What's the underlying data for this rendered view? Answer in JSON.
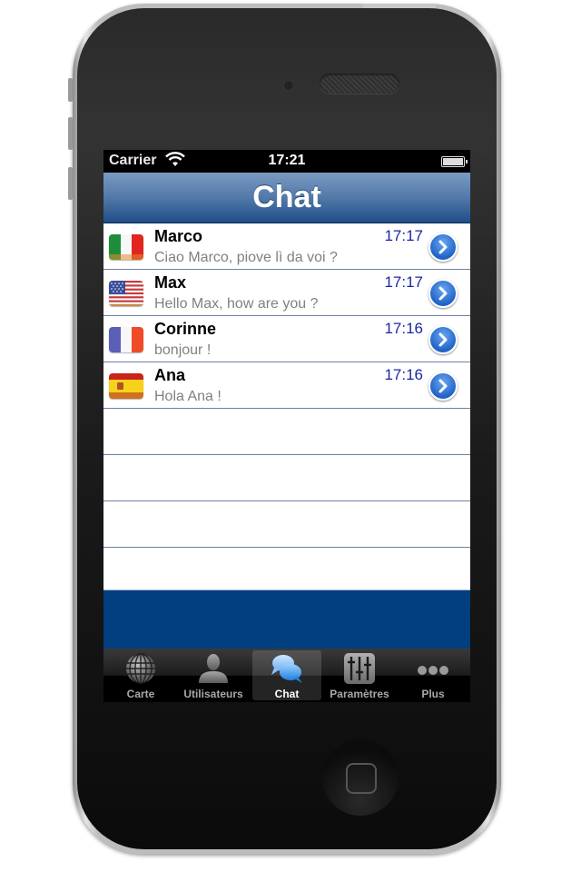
{
  "status_bar": {
    "carrier": "Carrier",
    "time": "17:21",
    "wifi_icon": "wifi-icon",
    "battery_icon": "battery-icon"
  },
  "nav_bar": {
    "title": "Chat"
  },
  "colors": {
    "nav_blue": "#1f4e8a",
    "time_blue": "#1a27a6",
    "band_blue": "#023f7e",
    "message_gray": "#808080"
  },
  "conversations": [
    {
      "name": "Marco",
      "message": "Ciao Marco, piove lì da voi ?",
      "time": "17:17",
      "flag": "italy-flag-icon"
    },
    {
      "name": "Max",
      "message": "Hello Max, how are you ?",
      "time": "17:17",
      "flag": "usa-flag-icon"
    },
    {
      "name": "Corinne",
      "message": "bonjour !",
      "time": "17:16",
      "flag": "france-flag-icon"
    },
    {
      "name": "Ana",
      "message": "Hola Ana !",
      "time": "17:16",
      "flag": "spain-flag-icon"
    }
  ],
  "tab_bar": {
    "selected": "Chat",
    "tabs": [
      {
        "label": "Carte",
        "icon": "globe-icon"
      },
      {
        "label": "Utilisateurs",
        "icon": "user-icon"
      },
      {
        "label": "Chat",
        "icon": "chat-bubbles-icon"
      },
      {
        "label": "Paramètres",
        "icon": "sliders-icon"
      },
      {
        "label": "Plus",
        "icon": "more-dots-icon"
      }
    ]
  }
}
